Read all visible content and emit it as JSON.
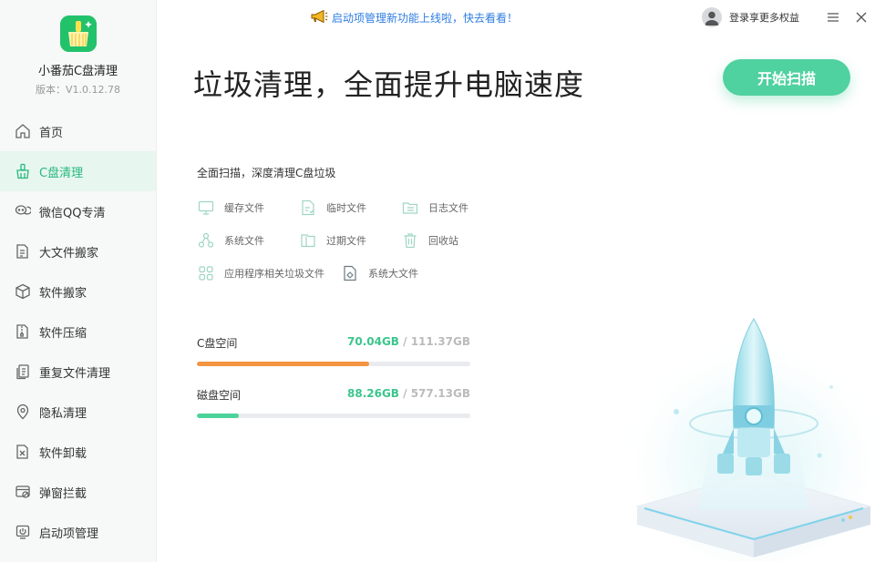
{
  "app": {
    "name": "小番茄C盘清理",
    "version": "版本：V1.0.12.78"
  },
  "colors": {
    "accent": "#25b97d",
    "button": "#4fd1a0",
    "orange": "#f39440",
    "green": "#4cd39a",
    "link": "#2f7de1"
  },
  "sidebar": {
    "items": [
      {
        "label": "首页",
        "icon": "home-icon"
      },
      {
        "label": "C盘清理",
        "icon": "broom-icon",
        "active": true
      },
      {
        "label": "微信QQ专清",
        "icon": "chat-icon"
      },
      {
        "label": "大文件搬家",
        "icon": "file-move-icon"
      },
      {
        "label": "软件搬家",
        "icon": "box-icon"
      },
      {
        "label": "软件压缩",
        "icon": "zip-icon"
      },
      {
        "label": "重复文件清理",
        "icon": "duplicate-icon"
      },
      {
        "label": "隐私清理",
        "icon": "privacy-icon"
      },
      {
        "label": "软件卸载",
        "icon": "uninstall-icon"
      },
      {
        "label": "弹窗拦截",
        "icon": "popup-block-icon"
      },
      {
        "label": "启动项管理",
        "icon": "power-icon"
      }
    ]
  },
  "topbar": {
    "announcement": "启动项管理新功能上线啦，快去看看！",
    "login": "登录享更多权益"
  },
  "main": {
    "headline": "垃圾清理，全面提升电脑速度",
    "scan_button": "开始扫描",
    "subtitle": "全面扫描，深度清理C盘垃圾",
    "categories": [
      {
        "label": "缓存文件",
        "icon": "monitor-icon"
      },
      {
        "label": "临时文件",
        "icon": "temp-file-icon"
      },
      {
        "label": "日志文件",
        "icon": "folder-log-icon"
      },
      {
        "label": "系统文件",
        "icon": "system-nodes-icon"
      },
      {
        "label": "过期文件",
        "icon": "expired-folder-icon"
      },
      {
        "label": "回收站",
        "icon": "trash-icon"
      },
      {
        "label": "应用程序相关垃圾文件",
        "icon": "apps-grid-icon"
      },
      {
        "label": "系统大文件",
        "icon": "gear-file-icon"
      }
    ],
    "disks": [
      {
        "label": "C盘空间",
        "used": "70.04GB",
        "total": " / 111.37GB",
        "fraction": 0.63
      },
      {
        "label": "磁盘空间",
        "used": "88.26GB",
        "total": " / 577.13GB",
        "fraction": 0.153
      }
    ]
  }
}
